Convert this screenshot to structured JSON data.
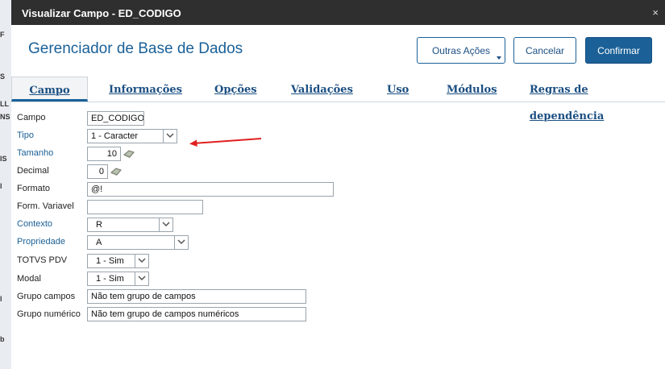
{
  "background_strip": [
    "F",
    "S",
    "LL",
    "NS",
    "IS",
    "l",
    "l",
    "b"
  ],
  "window": {
    "title": "Visualizar Campo - ED_CODIGO",
    "close_glyph": "×"
  },
  "header": {
    "title": "Gerenciador de Base de Dados"
  },
  "buttons": {
    "more_actions": "Outras Ações",
    "cancel": "Cancelar",
    "confirm": "Confirmar"
  },
  "tabs": [
    "Campo",
    "Informações",
    "Opções",
    "Validações",
    "Uso",
    "Módulos",
    "Regras de dependência"
  ],
  "fields": {
    "campo": {
      "label": "Campo",
      "value": "ED_CODIGO"
    },
    "tipo": {
      "label": "Tipo",
      "value": "1 - Caracter"
    },
    "tamanho": {
      "label": "Tamanho",
      "value": "10"
    },
    "decimal": {
      "label": "Decimal",
      "value": "0"
    },
    "formato": {
      "label": "Formato",
      "value": "@!"
    },
    "form_variavel": {
      "label": "Form. Variavel",
      "value": ""
    },
    "contexto": {
      "label": "Contexto",
      "value": "R"
    },
    "propriedade": {
      "label": "Propriedade",
      "value": "A"
    },
    "totvs_pdv": {
      "label": "TOTVS PDV",
      "value": "1 - Sim"
    },
    "modal": {
      "label": "Modal",
      "value": "1 - Sim"
    },
    "grupo_campos": {
      "label": "Grupo campos",
      "value": "Não tem grupo de campos"
    },
    "grupo_numerico": {
      "label": "Grupo numérico",
      "value": "Não tem grupo de campos numéricos"
    }
  },
  "colors": {
    "accent": "#1b6198",
    "annotation_arrow": "#e01f1f",
    "titlebar": "#2f2f2f"
  }
}
